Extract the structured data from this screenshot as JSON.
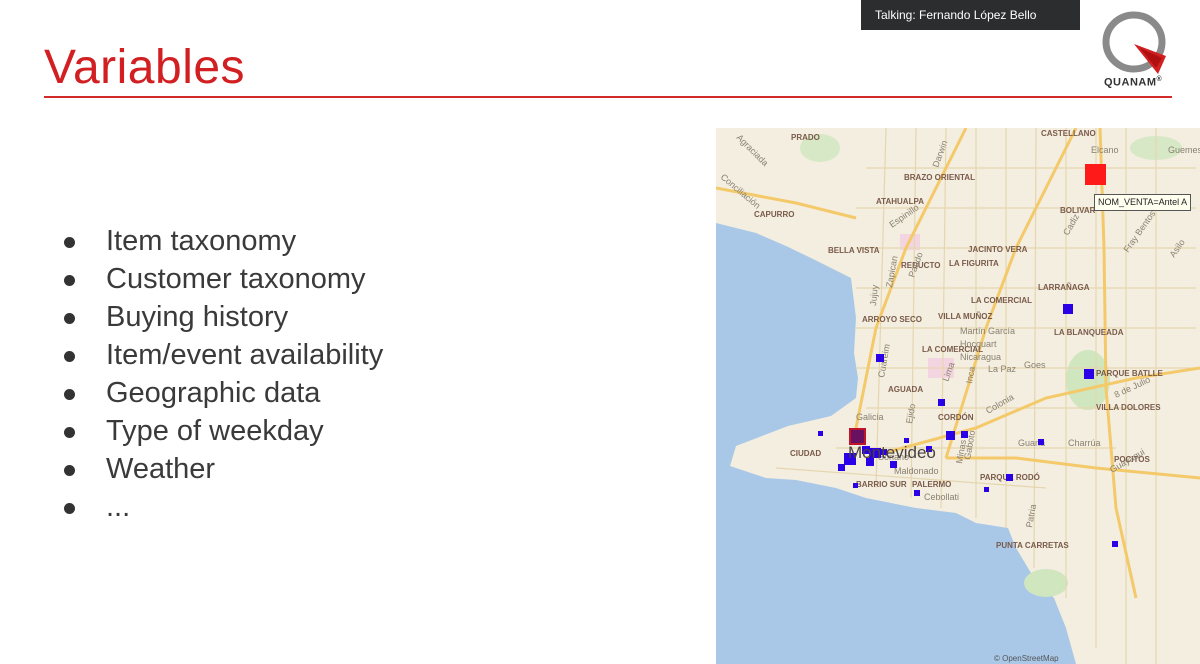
{
  "slide": {
    "title": "Variables",
    "bullets": [
      "Item taxonomy",
      "Customer taxonomy",
      "Buying history",
      "Item/event availability",
      "Geographic data",
      "Type of weekday",
      "Weather",
      "..."
    ]
  },
  "call": {
    "talking": "Talking: Fernando López Bello"
  },
  "logo": {
    "text": "QUANAM",
    "registered": "®"
  },
  "map": {
    "city": "Montevideo",
    "tooltip": "NOM_VENTA=Antel A",
    "credit": "© OpenStreetMap",
    "neighborhoods": [
      "PRADO",
      "CASTELLANO",
      "BRAZO ORIENTAL",
      "ATAHUALPA",
      "CAPURRO",
      "BOLIVAR",
      "BELLA VISTA",
      "JACINTO VERA",
      "REDUCTO",
      "LA FIGURITA",
      "LARRAÑAGA",
      "LA COMERCIAL",
      "ARROYO SECO",
      "VILLA MUÑOZ",
      "LA BLANQUEADA",
      "LA COMERCIAL",
      "PARQUE BATLLE",
      "AGUADA",
      "VILLA DOLORES",
      "CORDÓN",
      "CIUDAD",
      "POCITOS",
      "BARRIO SUR",
      "PALERMO",
      "PARQUE RODÓ",
      "PUNTA CARRETAS"
    ],
    "streets": [
      "Elcano",
      "Guemes",
      "Darwin",
      "Espinillo",
      "Cadiz",
      "Fray Bentos",
      "Asilo",
      "Pando",
      "Zapican",
      "Jujuy",
      "Martín García",
      "Hocquart",
      "Nicaragua",
      "La Paz",
      "Goes",
      "Lima",
      "Inca",
      "Cuareim",
      "Galicia",
      "Colonia",
      "Ejido",
      "Guaná",
      "Charrúa",
      "Maldonado",
      "Gaboto",
      "Minas",
      "Cebollati",
      "Patria",
      "Guayaqui",
      "8 de Julio",
      "Soriano",
      "Conciliación",
      "Agraciada"
    ],
    "marker_colors": {
      "sale": "#2a00e6",
      "highlight": "#ff1a1a"
    }
  }
}
